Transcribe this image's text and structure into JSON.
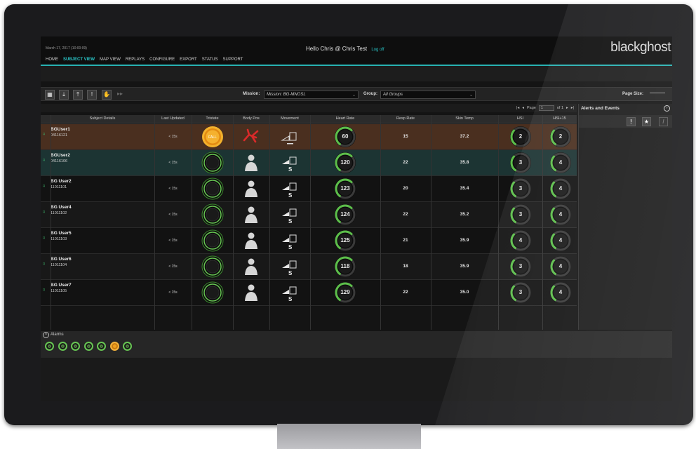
{
  "header": {
    "datetime": "March 17, 2017 (10:00:09)",
    "greeting": "Hello Chris @ Chris Test",
    "logoff": "Log off",
    "logo": "blackghost"
  },
  "nav": [
    "HOME",
    "SUBJECT VIEW",
    "MAP VIEW",
    "REPLAYS",
    "CONFIGURE",
    "EXPORT",
    "STATUS",
    "SUPPORT"
  ],
  "nav_active": "SUBJECT VIEW",
  "toolbar": {
    "mission_label": "Mission:",
    "mission_value": "Mission: BG-MNOSL",
    "group_label": "Group:",
    "group_value": "All Groups",
    "page_size_label": "Page Size:",
    "icons": [
      "grid-icon",
      "download-icon",
      "upload-icon",
      "alert-icon",
      "hand-icon",
      "fast-forward-icon"
    ]
  },
  "pager": {
    "page_label": "Page",
    "page_value": "1",
    "of_label": "of 1"
  },
  "columns": [
    "Subject Details",
    "Last Updated",
    "Tristate",
    "Body Pos",
    "Movement",
    "Heart Rate",
    "Resp Rate",
    "Skin Temp",
    "HSI",
    "HSI+15"
  ],
  "rows": [
    {
      "name": "BGUser1",
      "id": "04116121",
      "updated": "< 15s",
      "tristate": "FALL",
      "body": "fallen",
      "hr": "60",
      "resp": "15",
      "skin": "37.2",
      "hsi": "2",
      "hsi15": "2"
    },
    {
      "name": "BGUser2",
      "id": "04116106",
      "updated": "< 15s",
      "tristate": "",
      "body": "standing",
      "hr": "120",
      "resp": "22",
      "skin": "35.8",
      "hsi": "3",
      "hsi15": "4"
    },
    {
      "name": "BG User2",
      "id": "11011101",
      "updated": "< 15s",
      "tristate": "",
      "body": "standing",
      "hr": "123",
      "resp": "20",
      "skin": "35.4",
      "hsi": "3",
      "hsi15": "4"
    },
    {
      "name": "BG User4",
      "id": "11011102",
      "updated": "< 15s",
      "tristate": "",
      "body": "standing",
      "hr": "124",
      "resp": "22",
      "skin": "35.2",
      "hsi": "3",
      "hsi15": "4"
    },
    {
      "name": "BG User5",
      "id": "11011103",
      "updated": "< 15s",
      "tristate": "",
      "body": "standing",
      "hr": "125",
      "resp": "21",
      "skin": "35.9",
      "hsi": "4",
      "hsi15": "4"
    },
    {
      "name": "BG User6",
      "id": "11011104",
      "updated": "< 15s",
      "tristate": "",
      "body": "standing",
      "hr": "118",
      "resp": "18",
      "skin": "35.9",
      "hsi": "3",
      "hsi15": "4"
    },
    {
      "name": "BG User7",
      "id": "11011105",
      "updated": "< 15s",
      "tristate": "",
      "body": "standing",
      "hr": "129",
      "resp": "22",
      "skin": "35.0",
      "hsi": "3",
      "hsi15": "4"
    }
  ],
  "alerts": {
    "title": "Alerts and Events",
    "buttons": [
      "!",
      "★",
      "/"
    ]
  },
  "alarms": {
    "label": "Alarms",
    "dots": [
      "ok",
      "ok",
      "ok",
      "ok",
      "ok",
      "warning",
      "ok"
    ]
  },
  "colors": {
    "accent": "#29c4c6",
    "fall_row": "#4a2f1f",
    "selected_row": "#1c3433",
    "ok": "#67c553",
    "warning": "#f0a11e"
  }
}
